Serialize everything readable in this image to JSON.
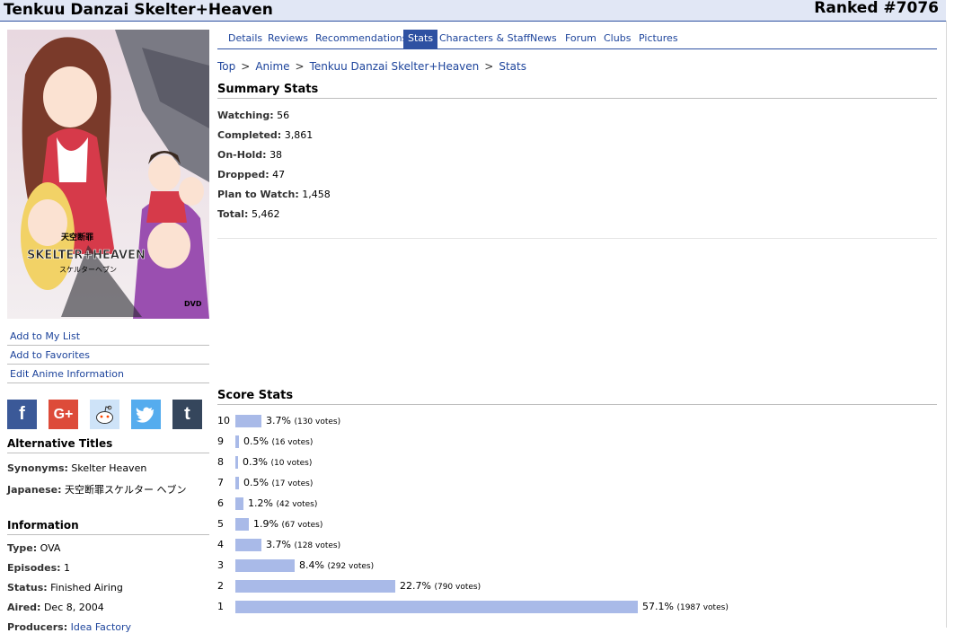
{
  "header": {
    "title": "Tenkuu Danzai Skelter+Heaven",
    "ranked": "Ranked #7076"
  },
  "cover": {
    "logo_line1": "天空断罪",
    "logo_line2": "SKELTER+HEAVEN",
    "logo_line3": "スケルターヘブン",
    "badge": "DVD"
  },
  "sidebar": {
    "links": [
      "Add to My List",
      "Add to Favorites",
      "Edit Anime Information"
    ],
    "social": [
      {
        "icon": "facebook-icon",
        "glyph": "f",
        "color": "#3b5998"
      },
      {
        "icon": "google-plus-icon",
        "glyph": "G+",
        "color": "#dd4b39"
      },
      {
        "icon": "reddit-icon",
        "glyph": "",
        "color": "#cee3f8"
      },
      {
        "icon": "twitter-icon",
        "glyph": "",
        "color": "#55acee"
      },
      {
        "icon": "tumblr-icon",
        "glyph": "t",
        "color": "#35465c"
      }
    ],
    "alt_titles_heading": "Alternative Titles",
    "synonyms_label": "Synonyms:",
    "synonyms_value": "Skelter Heaven",
    "japanese_label": "Japanese:",
    "japanese_value": "天空断罪スケルター ヘブン",
    "info_heading": "Information",
    "type_label": "Type:",
    "type_value": "OVA",
    "episodes_label": "Episodes:",
    "episodes_value": "1",
    "status_label": "Status:",
    "status_value": "Finished Airing",
    "aired_label": "Aired:",
    "aired_value": "Dec 8, 2004",
    "producers_label": "Producers:",
    "producers_value": "Idea Factory"
  },
  "tabs": [
    "Details",
    "Reviews",
    "Recommendations",
    "Stats",
    "Characters & Staff",
    "News",
    "Forum",
    "Clubs",
    "Pictures"
  ],
  "active_tab": "Stats",
  "breadcrumb": [
    "Top",
    "Anime",
    "Tenkuu Danzai Skelter+Heaven",
    "Stats"
  ],
  "summary": {
    "heading": "Summary Stats",
    "rows": [
      {
        "label": "Watching:",
        "value": "56"
      },
      {
        "label": "Completed:",
        "value": "3,861"
      },
      {
        "label": "On-Hold:",
        "value": "38"
      },
      {
        "label": "Dropped:",
        "value": "47"
      },
      {
        "label": "Plan to Watch:",
        "value": "1,458"
      },
      {
        "label": "Total:",
        "value": "5,462"
      }
    ]
  },
  "score": {
    "heading": "Score Stats",
    "rows": [
      {
        "score": "10",
        "percent": "3.7%",
        "votes": "(130 votes)",
        "fraction": 0.037
      },
      {
        "score": "9",
        "percent": "0.5%",
        "votes": "(16 votes)",
        "fraction": 0.005
      },
      {
        "score": "8",
        "percent": "0.3%",
        "votes": "(10 votes)",
        "fraction": 0.003
      },
      {
        "score": "7",
        "percent": "0.5%",
        "votes": "(17 votes)",
        "fraction": 0.005
      },
      {
        "score": "6",
        "percent": "1.2%",
        "votes": "(42 votes)",
        "fraction": 0.012
      },
      {
        "score": "5",
        "percent": "1.9%",
        "votes": "(67 votes)",
        "fraction": 0.019
      },
      {
        "score": "4",
        "percent": "3.7%",
        "votes": "(128 votes)",
        "fraction": 0.037
      },
      {
        "score": "3",
        "percent": "8.4%",
        "votes": "(292 votes)",
        "fraction": 0.084
      },
      {
        "score": "2",
        "percent": "22.7%",
        "votes": "(790 votes)",
        "fraction": 0.227
      },
      {
        "score": "1",
        "percent": "57.1%",
        "votes": "(1987 votes)",
        "fraction": 0.571
      }
    ]
  }
}
